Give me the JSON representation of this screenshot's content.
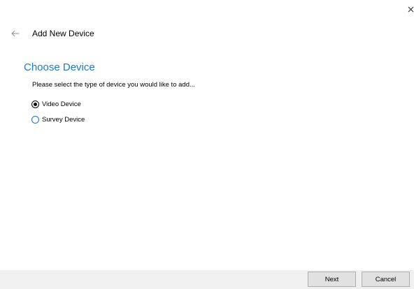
{
  "window": {
    "title": "Add New Device",
    "close_icon": "close-icon",
    "back_icon": "back-arrow-icon"
  },
  "content": {
    "heading": "Choose Device",
    "instruction": "Please select the type of device you would like to add...",
    "options": [
      {
        "label": "Video Device",
        "selected": true
      },
      {
        "label": "Survey Device",
        "selected": false
      }
    ]
  },
  "footer": {
    "next_label": "Next",
    "cancel_label": "Cancel"
  },
  "colors": {
    "accent": "#1979ca",
    "radio_unselected_border": "#1a73d4",
    "footer_background": "#f0f0f0",
    "button_background": "#e1e1e1"
  }
}
